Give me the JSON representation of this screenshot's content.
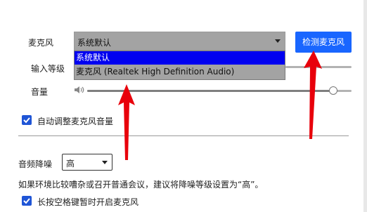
{
  "microphone": {
    "label": "麦克风",
    "selected": "系统默认",
    "options": [
      "系统默认",
      "麦克风 (Realtek High Definition Audio)"
    ],
    "detect_button": "检测麦克风"
  },
  "input_level": {
    "label": "输入等级"
  },
  "volume": {
    "label": "音量",
    "level": 0.93
  },
  "auto_adjust": {
    "label": "自动调整麦克风音量",
    "checked": true
  },
  "noise_reduction": {
    "label": "音频降噪",
    "selected": "高",
    "hint": "如果环境比较嘈杂或召开普通会议，建议将降噪等级设置为“高”。"
  },
  "space_to_unmute": {
    "label": "长按空格键暂时开启麦克风",
    "checked": true
  },
  "colors": {
    "accent": "#1966ff",
    "annotation": "#e8000b",
    "highlight": "#0000f0"
  }
}
